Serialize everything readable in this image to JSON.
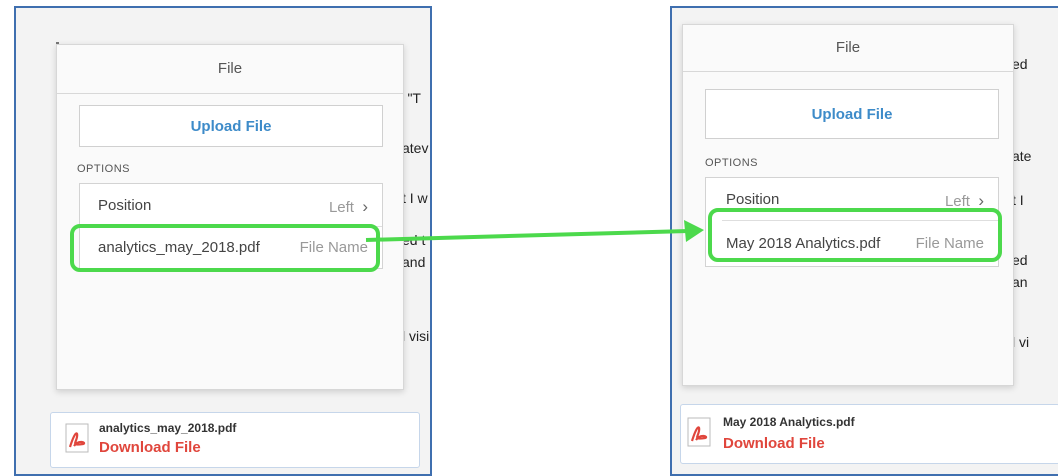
{
  "left": {
    "popover_title": "File",
    "upload_label": "Upload File",
    "options_label": "OPTIONS",
    "position_label": "Position",
    "position_value": "Left",
    "filename_value": "analytics_may_2018.pdf",
    "filename_label": "File Name",
    "attachment_name": "analytics_may_2018.pdf",
    "attachment_action": "Download File",
    "bg_fragments": [
      "ed \"T",
      "atev",
      "t I w",
      "ed t",
      "and",
      "l visi"
    ]
  },
  "right": {
    "popover_title": "File",
    "upload_label": "Upload File",
    "options_label": "OPTIONS",
    "position_label": "Position",
    "position_value": "Left",
    "filename_value": "May 2018 Analytics.pdf",
    "filename_label": "File Name",
    "attachment_name": "May 2018 Analytics.pdf",
    "attachment_action": "Download File",
    "bg_fragments": [
      "ed",
      "ate",
      "t I",
      "ed",
      "an",
      "l vi"
    ]
  },
  "icons": {
    "chevron": "›",
    "pdf": "pdf-icon"
  },
  "colors": {
    "frame_border": "#3f6faf",
    "highlight": "#4cd94c",
    "link_blue": "#3d8bc9",
    "download_red": "#e0463c"
  }
}
